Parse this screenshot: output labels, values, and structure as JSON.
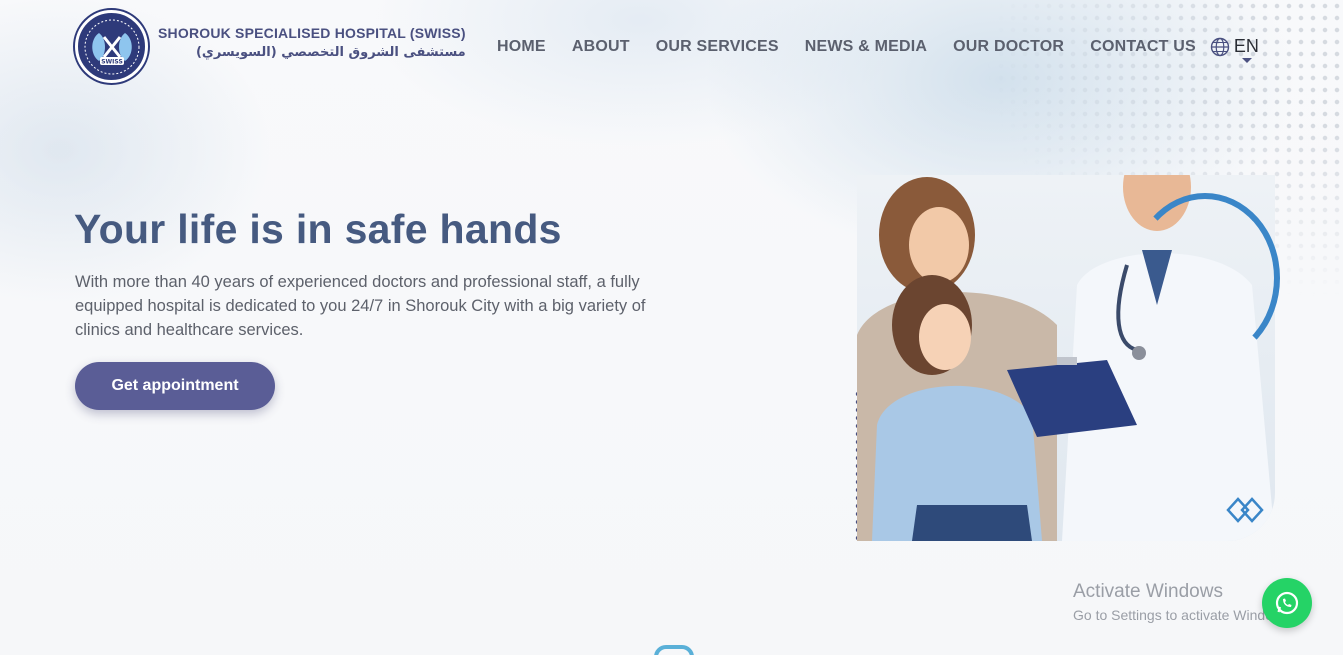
{
  "brand": {
    "name_en": "SHOROUK SPECIALISED HOSPITAL (SWISS)",
    "name_ar": "مستشفى الشروق التخصصي (السويسري)",
    "logo_text": "SWISS"
  },
  "nav": {
    "items": [
      {
        "label": "HOME"
      },
      {
        "label": "ABOUT"
      },
      {
        "label": "OUR SERVICES"
      },
      {
        "label": "NEWS & MEDIA"
      },
      {
        "label": "OUR DOCTOR"
      },
      {
        "label": "CONTACT US"
      }
    ],
    "language": "EN"
  },
  "hero": {
    "title": "Your life is in safe hands",
    "description": "With more than 40 years of experienced doctors and professional staff, a fully equipped hospital is dedicated to you 24/7 in Shorouk City with a big variety of clinics and healthcare services.",
    "cta_label": "Get appointment"
  },
  "windows_watermark": {
    "title": "Activate Windows",
    "subtitle": "Go to Settings to activate Windows."
  },
  "colors": {
    "brand": "#4a5080",
    "cta": "#5a5d96",
    "heading": "#465a80",
    "accent_blue": "#3a86c8",
    "whatsapp": "#25d366"
  },
  "icons": {
    "language": "globe-icon",
    "chat": "whatsapp-icon"
  }
}
